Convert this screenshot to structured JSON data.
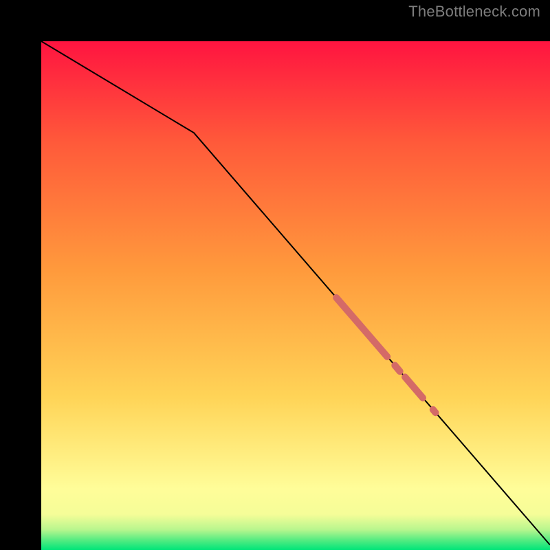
{
  "attribution": "TheBottleneck.com",
  "chart_data": {
    "type": "line",
    "title": "",
    "xlabel": "",
    "ylabel": "",
    "xlim": [
      0,
      100
    ],
    "ylim": [
      0,
      100
    ],
    "grid": false,
    "background_gradient": [
      {
        "pos": 0.0,
        "color": "#00e579"
      },
      {
        "pos": 0.02,
        "color": "#57ec82"
      },
      {
        "pos": 0.04,
        "color": "#b8f68e"
      },
      {
        "pos": 0.07,
        "color": "#f5fd98"
      },
      {
        "pos": 0.12,
        "color": "#fffd99"
      },
      {
        "pos": 0.3,
        "color": "#ffd457"
      },
      {
        "pos": 0.55,
        "color": "#ff9a3c"
      },
      {
        "pos": 0.8,
        "color": "#ff5a3a"
      },
      {
        "pos": 1.0,
        "color": "#ff1440"
      }
    ],
    "series": [
      {
        "name": "curve",
        "stroke": "#000000",
        "stroke_width": 2,
        "x": [
          0,
          30,
          100
        ],
        "y": [
          100,
          82,
          1
        ]
      }
    ],
    "markers": [
      {
        "name": "highlight-segment",
        "stroke": "#d46a67",
        "stroke_width": 10,
        "linecap": "round",
        "x": [
          58,
          68
        ],
        "y": [
          49.6,
          38.0
        ]
      },
      {
        "name": "highlight-dot-a",
        "stroke": "#d46a67",
        "stroke_width": 10,
        "linecap": "round",
        "x": [
          69.5,
          70.5
        ],
        "y": [
          36.3,
          35.1
        ]
      },
      {
        "name": "highlight-seg-b",
        "stroke": "#d46a67",
        "stroke_width": 10,
        "linecap": "round",
        "x": [
          71.5,
          75
        ],
        "y": [
          34.0,
          29.9
        ]
      },
      {
        "name": "highlight-dot-c",
        "stroke": "#d46a67",
        "stroke_width": 10,
        "linecap": "round",
        "x": [
          77,
          77.5
        ],
        "y": [
          27.6,
          27.0
        ]
      }
    ]
  }
}
